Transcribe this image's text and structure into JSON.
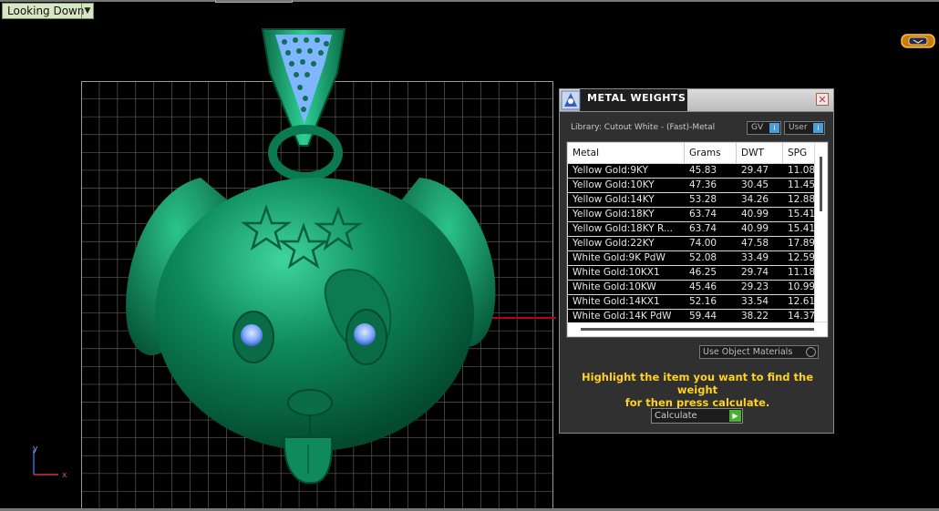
{
  "viewport": {
    "view_label": "Looking Down",
    "axis": {
      "y_label": "y",
      "x_label": "x"
    }
  },
  "dialog": {
    "title": "METAL WEIGHTS",
    "library_label": "Library: Cutout White - (Fast)-Metal",
    "gv_label": "GV",
    "user_label": "User",
    "columns": [
      "Metal",
      "Grams",
      "DWT",
      "SPG"
    ],
    "rows": [
      {
        "metal": "Yellow Gold:9KY",
        "grams": "45.83",
        "dwt": "29.47",
        "spg": "11.08"
      },
      {
        "metal": "Yellow Gold:10KY",
        "grams": "47.36",
        "dwt": "30.45",
        "spg": "11.45"
      },
      {
        "metal": "Yellow Gold:14KY",
        "grams": "53.28",
        "dwt": "34.26",
        "spg": "12.88"
      },
      {
        "metal": "Yellow Gold:18KY",
        "grams": "63.74",
        "dwt": "40.99",
        "spg": "15.41"
      },
      {
        "metal": "Yellow Gold:18KY R...",
        "grams": "63.74",
        "dwt": "40.99",
        "spg": "15.41"
      },
      {
        "metal": "Yellow Gold:22KY",
        "grams": "74.00",
        "dwt": "47.58",
        "spg": "17.89"
      },
      {
        "metal": "White Gold:9K PdW",
        "grams": "52.08",
        "dwt": "33.49",
        "spg": "12.59"
      },
      {
        "metal": "White Gold:10KX1",
        "grams": "46.25",
        "dwt": "29.74",
        "spg": "11.18"
      },
      {
        "metal": "White Gold:10KW",
        "grams": "45.46",
        "dwt": "29.23",
        "spg": "10.99"
      },
      {
        "metal": "White Gold:14KX1",
        "grams": "52.16",
        "dwt": "33.54",
        "spg": "12.61"
      },
      {
        "metal": "White Gold:14K PdW",
        "grams": "59.44",
        "dwt": "38.22",
        "spg": "14.37"
      }
    ],
    "use_materials_label": "Use Object Materials",
    "hint_line1": "Highlight the item you want to find the weight",
    "hint_line2": "for then press calculate.",
    "calculate_label": "Calculate"
  },
  "colors": {
    "model_green": "#0f8a5c",
    "hint_yellow": "#ffd21e",
    "stone_blue": "#7fa9ff"
  }
}
